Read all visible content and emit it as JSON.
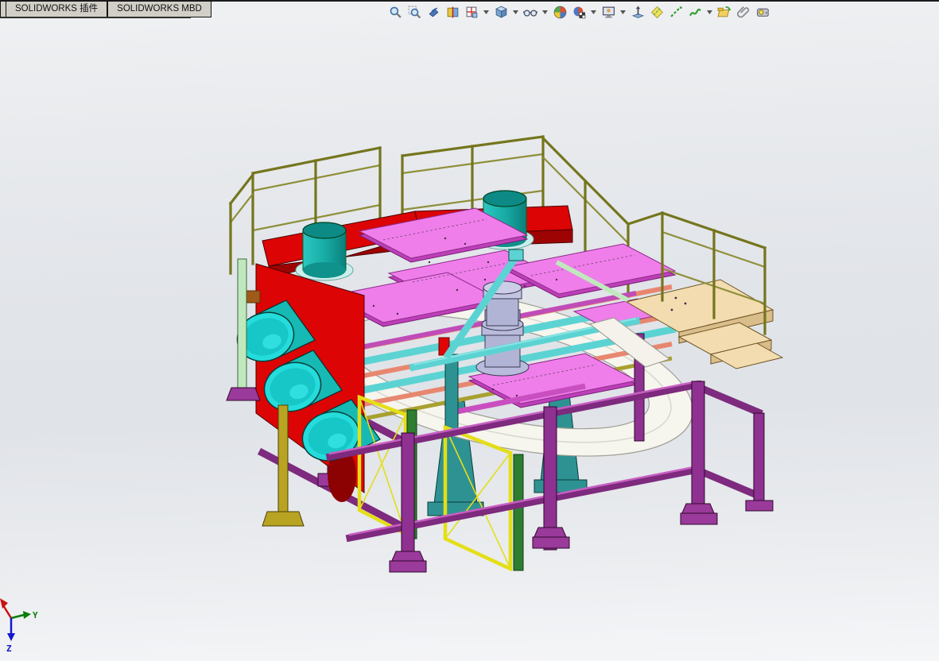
{
  "tabs": [
    {
      "label": "SOLIDWORKS 插件"
    },
    {
      "label": "SOLIDWORKS MBD"
    }
  ],
  "toolbar": {
    "buttons": [
      {
        "name": "zoom-to-fit",
        "icon": "magnifier-icon"
      },
      {
        "name": "zoom-to-area",
        "icon": "magnifier-area-icon"
      },
      {
        "name": "previous-view",
        "icon": "spyglass-arrow-icon"
      },
      {
        "name": "section-view",
        "icon": "section-cube-icon"
      },
      {
        "name": "view-orientation",
        "icon": "orientation-cube-icon",
        "dropdown": true
      },
      {
        "name": "display-style",
        "icon": "shaded-cube-icon",
        "dropdown": true
      },
      {
        "name": "hide-show-items",
        "icon": "eyeglasses-icon",
        "dropdown": true
      },
      {
        "name": "edit-appearance",
        "icon": "color-sphere-icon"
      },
      {
        "name": "apply-scene",
        "icon": "scene-sphere-icon",
        "dropdown": true
      },
      {
        "name": "view-settings",
        "icon": "monitor-hand-icon",
        "dropdown": true
      },
      {
        "name": "instant3d",
        "icon": "arrow-plane-icon"
      },
      {
        "name": "planes-visibility",
        "icon": "plane-diamond-icon"
      },
      {
        "name": "axes-visibility",
        "icon": "dashed-axis-icon"
      },
      {
        "name": "curves-visibility",
        "icon": "curve-icon",
        "dropdown": true
      },
      {
        "name": "reuse-file",
        "icon": "folder-arrows-icon"
      },
      {
        "name": "attachments",
        "icon": "paperclip-icon"
      },
      {
        "name": "measure",
        "icon": "tape-measure-icon"
      }
    ]
  },
  "viewport": {
    "triad": {
      "y_label": "Y",
      "z_label": "Z"
    }
  },
  "model": {
    "type": "3d-cad-assembly",
    "parts": [
      "back-safety-railings",
      "red-hopper-platform",
      "teal-vertical-hoppers",
      "pink-tooling-plates",
      "oval-conveyor-track",
      "center-rotary-motor",
      "red-side-panels",
      "teal-side-cylinders",
      "operator-platform-tan",
      "platform-railings",
      "yellow-fence-panels",
      "purple-base-frame",
      "teal-support-pedestals",
      "deck-cross-beams"
    ],
    "colors": {
      "frame_purple": "#8e3190",
      "plate_pink": "#ef7eea",
      "panel_red": "#dc0404",
      "cylinder_teal": "#17b9b4",
      "railing_olive": "#75751d",
      "beam_aqua": "#5cd3d3",
      "beam_salmon": "#e8876f",
      "beam_pale_green": "#bfe9bd",
      "fence_yellow": "#e4de18",
      "platform_tan": "#f3dcb0",
      "track_white": "#f6f5ee",
      "motor_lavender": "#b9bbdc"
    }
  }
}
